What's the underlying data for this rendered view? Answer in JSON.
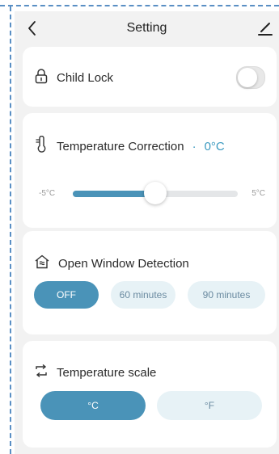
{
  "header": {
    "title": "Setting",
    "back_icon": "chevron-left-icon",
    "edit_icon": "pencil-icon"
  },
  "child_lock": {
    "label": "Child Lock",
    "icon": "lock-icon",
    "enabled": false
  },
  "temperature_correction": {
    "label": "Temperature Correction",
    "separator": "·",
    "value_label": "0°C",
    "icon": "thermometer-icon",
    "slider": {
      "min_label": "-5°C",
      "max_label": "5°C",
      "min": -5,
      "max": 5,
      "value": 0
    }
  },
  "open_window_detection": {
    "label": "Open Window Detection",
    "icon": "window-house-icon",
    "options": [
      "OFF",
      "60 minutes",
      "90 minutes"
    ],
    "selected_index": 0
  },
  "temperature_scale": {
    "label": "Temperature scale",
    "icon": "swap-icon",
    "options": [
      "°C",
      "°F"
    ],
    "selected_index": 0
  },
  "colors": {
    "accent": "#4a93b8",
    "accent_text": "#3d9bc1",
    "inactive_pill": "#e7f2f6",
    "background": "#f2f2f2"
  }
}
